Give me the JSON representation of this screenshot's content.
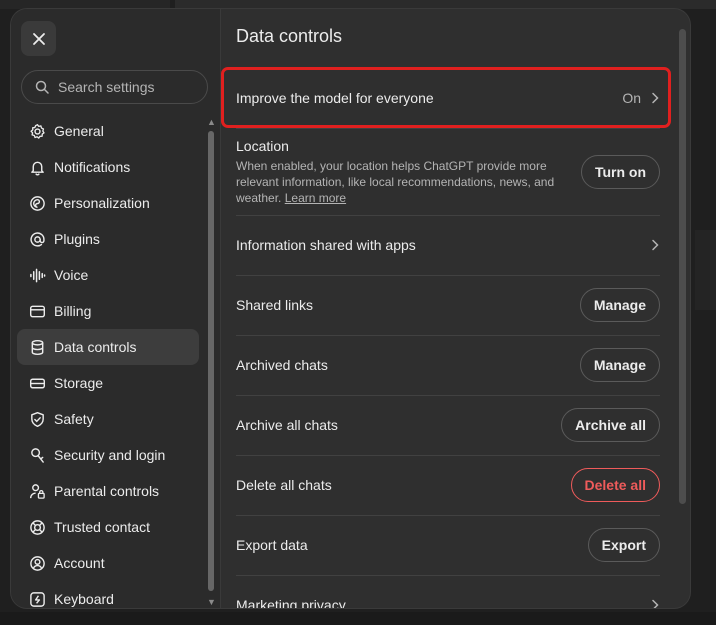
{
  "sidebar": {
    "search_placeholder": "Search settings",
    "items": [
      {
        "label": "General",
        "icon": "gear-icon"
      },
      {
        "label": "Notifications",
        "icon": "bell-icon"
      },
      {
        "label": "Personalization",
        "icon": "personalization-icon"
      },
      {
        "label": "Plugins",
        "icon": "at-sign-icon"
      },
      {
        "label": "Voice",
        "icon": "waveform-icon"
      },
      {
        "label": "Billing",
        "icon": "credit-card-icon"
      },
      {
        "label": "Data controls",
        "icon": "database-icon",
        "active": true
      },
      {
        "label": "Storage",
        "icon": "storage-icon"
      },
      {
        "label": "Safety",
        "icon": "shield-check-icon"
      },
      {
        "label": "Security and login",
        "icon": "key-icon"
      },
      {
        "label": "Parental controls",
        "icon": "person-lock-icon"
      },
      {
        "label": "Trusted contact",
        "icon": "lifebuoy-icon"
      },
      {
        "label": "Account",
        "icon": "user-circle-icon"
      },
      {
        "label": "Keyboard",
        "icon": "keyboard-icon"
      }
    ]
  },
  "main": {
    "title": "Data controls",
    "improve": {
      "label": "Improve the model for everyone",
      "value": "On"
    },
    "location": {
      "label": "Location",
      "description": "When enabled, your location helps ChatGPT provide more relevant information, like local recommendations, news, and weather.",
      "learn_more": "Learn more",
      "button": "Turn on"
    },
    "info_apps": {
      "label": "Information shared with apps"
    },
    "shared_links": {
      "label": "Shared links",
      "button": "Manage"
    },
    "archived_chats": {
      "label": "Archived chats",
      "button": "Manage"
    },
    "archive_all": {
      "label": "Archive all chats",
      "button": "Archive all"
    },
    "delete_all": {
      "label": "Delete all chats",
      "button": "Delete all"
    },
    "export": {
      "label": "Export data",
      "button": "Export"
    },
    "marketing": {
      "label": "Marketing privacy"
    }
  },
  "colors": {
    "highlight": "#e0201f",
    "danger": "#ef5b5b",
    "panel": "#2f2f2f"
  }
}
